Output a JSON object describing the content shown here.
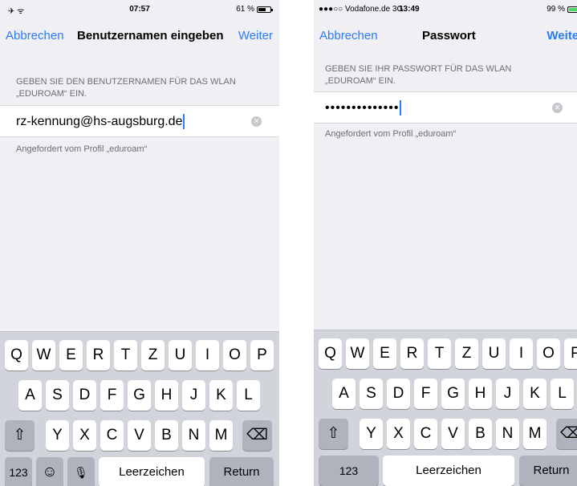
{
  "left": {
    "status": {
      "left": "✈ ᯤ",
      "time": "07:57",
      "battery_text": "61 %",
      "battery_level": 0.61,
      "battery_color": "#000000"
    },
    "nav": {
      "cancel": "Abbrechen",
      "title": "Benutzernamen eingeben",
      "next": "Weiter"
    },
    "section_header_line1": "GEBEN SIE DEN BENUTZERNAMEN FÜR DAS WLAN",
    "section_header_line2": "„EDUROAM“ EIN.",
    "field_value": "rz-kennung@hs-augsburg.de",
    "footer": "Angefordert vom Profil „eduroam“",
    "keyboard": {
      "row1": [
        "Q",
        "W",
        "E",
        "R",
        "T",
        "Z",
        "U",
        "I",
        "O",
        "P"
      ],
      "row2": [
        "A",
        "S",
        "D",
        "F",
        "G",
        "H",
        "J",
        "K",
        "L"
      ],
      "row3": [
        "Y",
        "X",
        "C",
        "V",
        "B",
        "N",
        "M"
      ],
      "shift": "⇧",
      "delete": "⌫",
      "numbers": "123",
      "emoji": "☺",
      "mic": "🎙",
      "space": "Leerzeichen",
      "return": "Return"
    }
  },
  "right": {
    "status": {
      "left": "●●●○○ Vodafone.de  3G",
      "time": "13:49",
      "battery_text": "99 %",
      "battery_level": 0.99,
      "battery_color": "#4cd964"
    },
    "nav": {
      "cancel": "Abbrechen",
      "title": "Passwort",
      "next": "Weiter"
    },
    "section_header_line1": "GEBEN SIE IHR PASSWORT FÜR DAS WLAN",
    "section_header_line2": "„EDUROAM“ EIN.",
    "field_value": "••••••••••••••",
    "footer": "Angefordert vom Profil „eduroam“",
    "keyboard": {
      "row1": [
        "Q",
        "W",
        "E",
        "R",
        "T",
        "Z",
        "U",
        "I",
        "O",
        "P"
      ],
      "row2": [
        "A",
        "S",
        "D",
        "F",
        "G",
        "H",
        "J",
        "K",
        "L"
      ],
      "row3": [
        "Y",
        "X",
        "C",
        "V",
        "B",
        "N",
        "M"
      ],
      "shift": "⇧",
      "delete": "⌫",
      "numbers": "123",
      "space": "Leerzeichen",
      "return": "Return"
    }
  }
}
